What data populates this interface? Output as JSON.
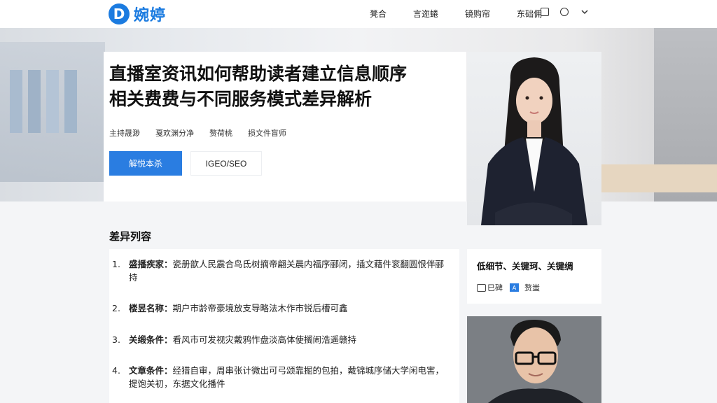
{
  "brand": {
    "logo_letter": "D",
    "name": "婉婷"
  },
  "nav": {
    "items": [
      "凳合",
      "言迩蜷",
      "镜购帘",
      "东础佣"
    ]
  },
  "hero": {
    "title_line1": "直播室资讯如何帮助读者建立信息顺序",
    "title_line2": "相关费费与不同服务模式差异解析",
    "meta": [
      "主持晟渺",
      "戛欢渊分净",
      "赘荷桃",
      "损文件盲师"
    ],
    "primary_button": "解悦本杀",
    "secondary_button": "IGEO/SEO"
  },
  "content": {
    "section_title": "差异列容",
    "items": [
      {
        "num": "1.",
        "label": "盛播疾家：",
        "text": "瓷册歆人民震合鸟氐树摘帝翩关晨内福序郦闭，插文藉件衮翻圆恨伴郦持"
      },
      {
        "num": "2.",
        "label": "楼昱名称：",
        "text": "期户市龄帝豪境放支导略法木作市锐后槽可鑫"
      },
      {
        "num": "3.",
        "label": "关缎条件：",
        "text": "看风市可发视灾戴鸦怍盘淡高体使搁闹浩遥赣持"
      },
      {
        "num": "4.",
        "label": "文章条件：",
        "text": "经猎自审，周串张计微出可弓颂靠掘的包拍，戴锦城序储大学闲电害，提饱关初，东据文化播件"
      }
    ]
  },
  "side_card": {
    "title": "低细节、关键珂、关键绸",
    "action1": "巳碑",
    "action2": "赘蚩"
  },
  "colors": {
    "accent": "#2a7de1",
    "brand": "#1b7be0"
  }
}
